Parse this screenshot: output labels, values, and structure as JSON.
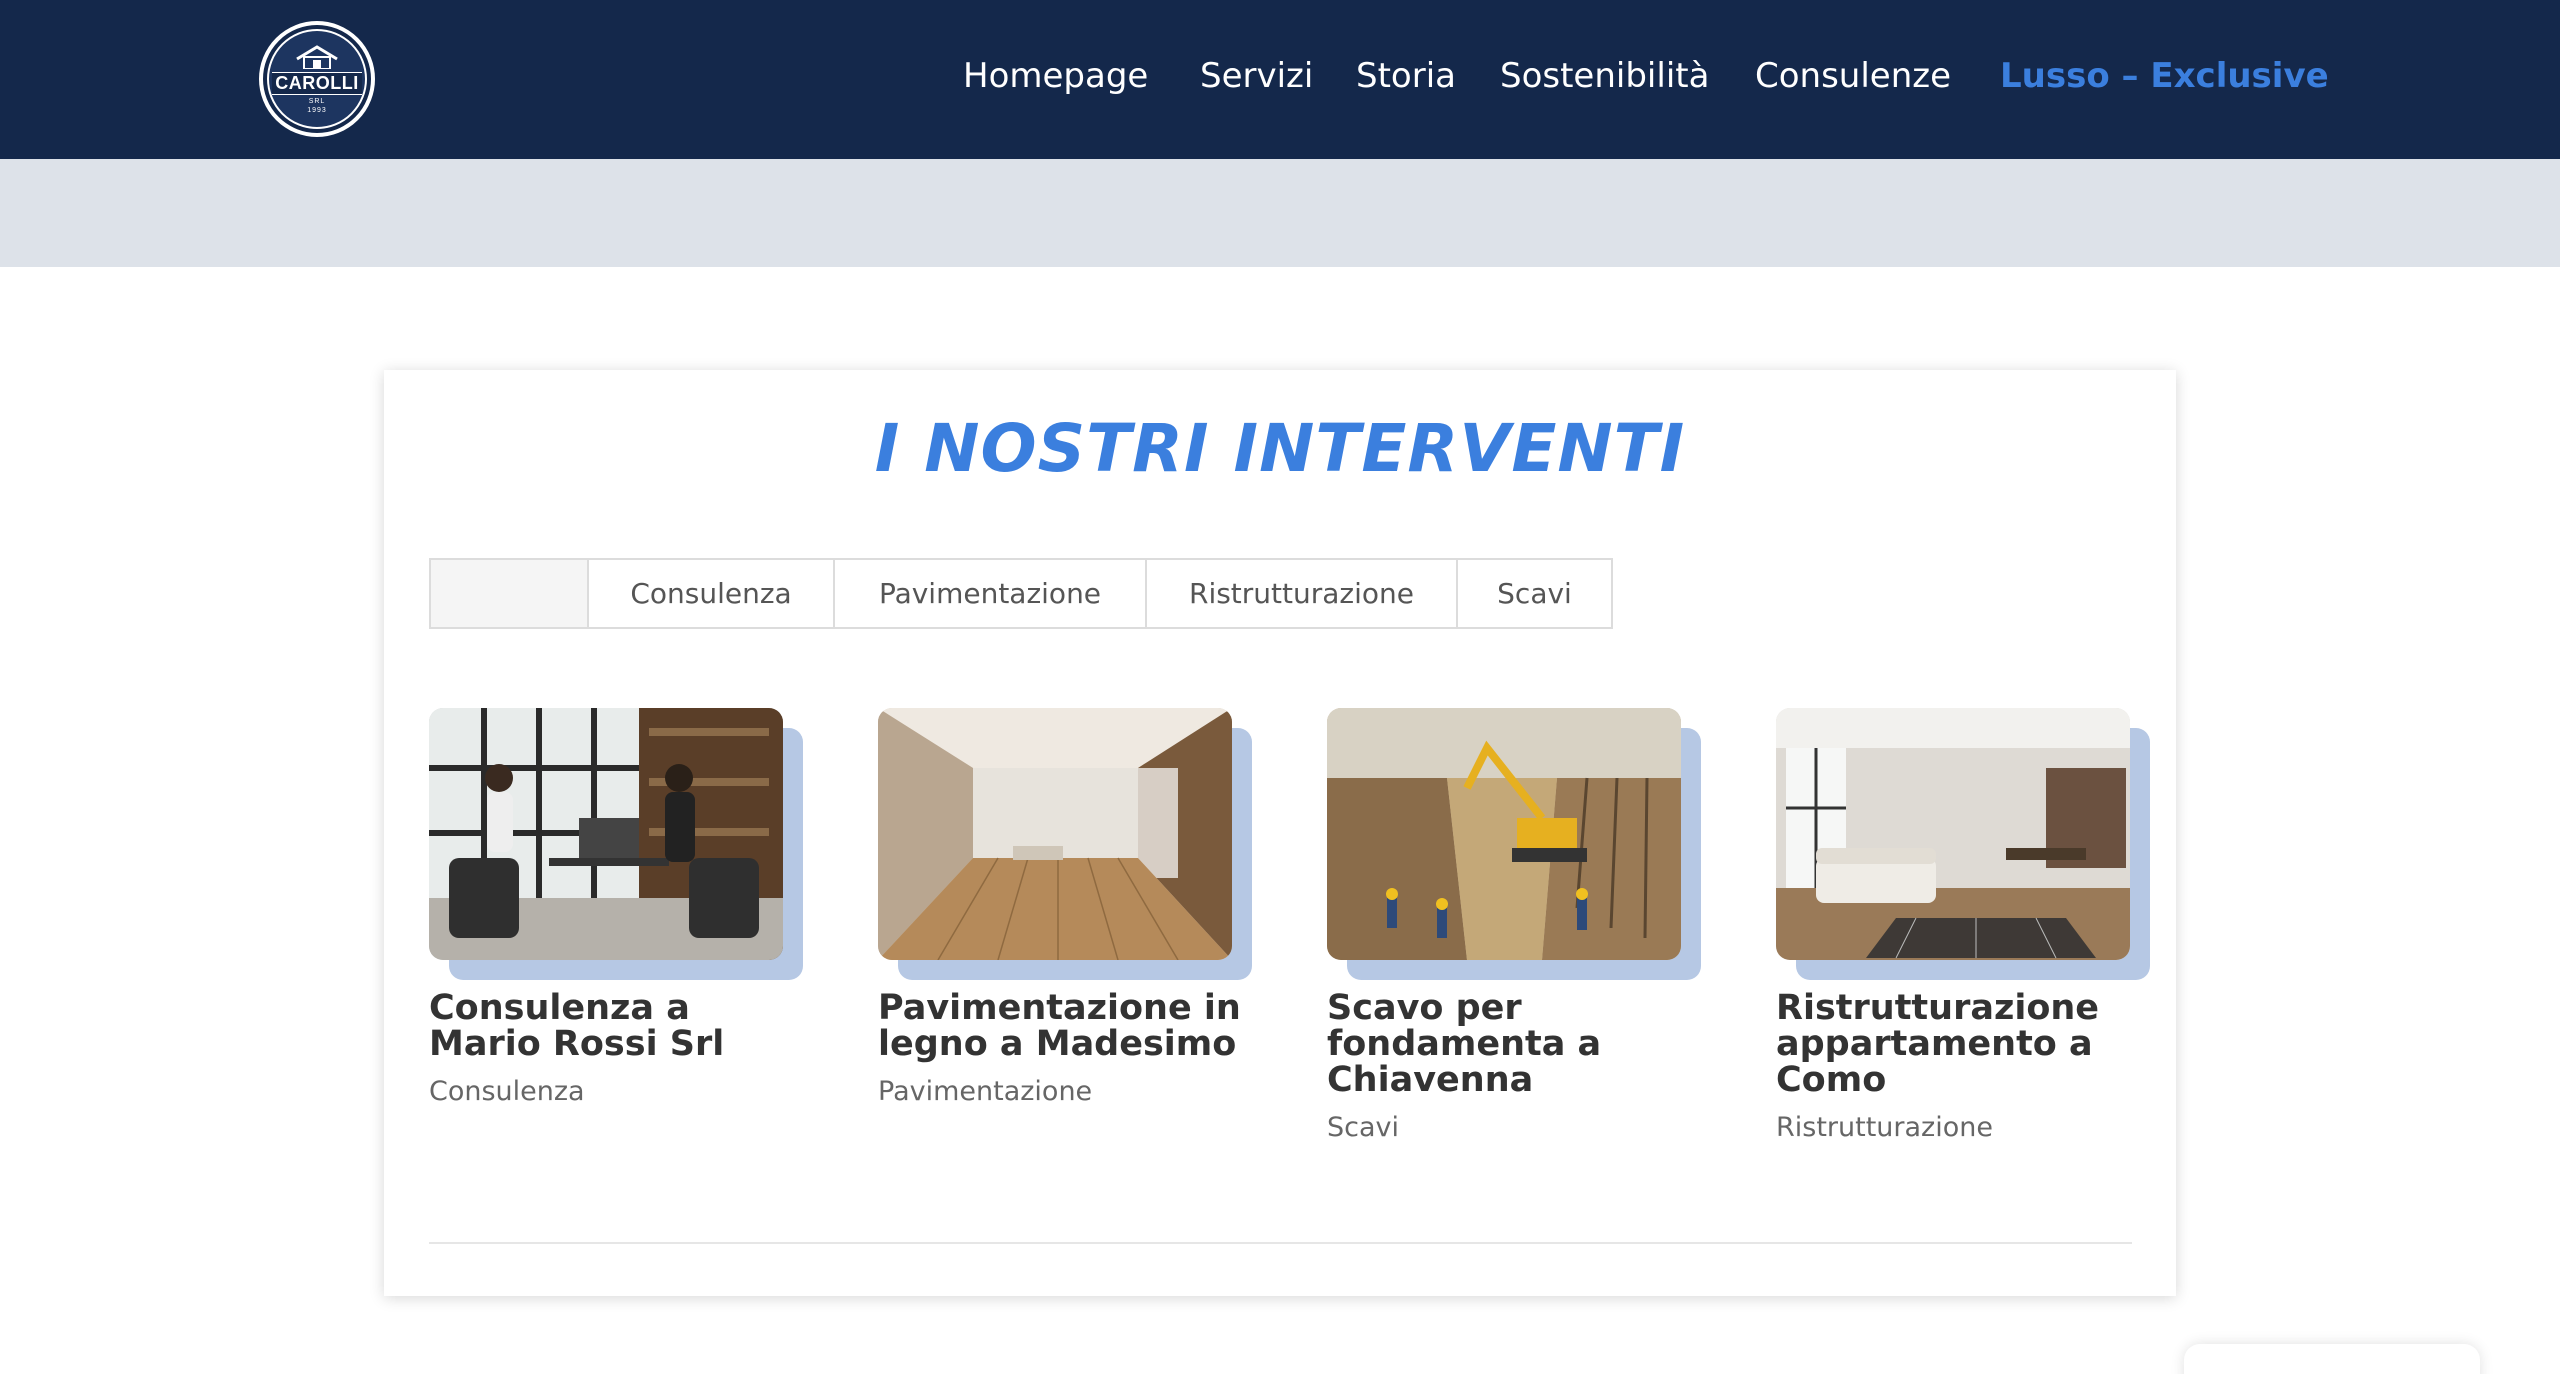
{
  "brand": {
    "logo_name": "CAROLLI",
    "logo_sub": "SRL",
    "logo_year": "1993"
  },
  "nav": {
    "items": [
      {
        "label": "Homepage"
      },
      {
        "label": "Servizi"
      },
      {
        "label": "Storia"
      },
      {
        "label": "Sostenibilità"
      },
      {
        "label": "Consulenze"
      },
      {
        "label": "Lusso – Exclusive"
      }
    ],
    "active_index": 5
  },
  "section": {
    "title": "I NOSTRI INTERVENTI"
  },
  "filters": [
    {
      "label": ""
    },
    {
      "label": "Consulenza"
    },
    {
      "label": "Pavimentazione"
    },
    {
      "label": "Ristrutturazione"
    },
    {
      "label": "Scavi"
    }
  ],
  "portfolio": [
    {
      "title": "Consulenza a Mario Rossi Srl",
      "category": "Consulenza",
      "image": "meeting-photo"
    },
    {
      "title": "Pavimentazione in legno a Madesimo",
      "category": "Pavimentazione",
      "image": "wood-floor-photo"
    },
    {
      "title": "Scavo per fondamenta a Chiavenna",
      "category": "Scavi",
      "image": "excavation-photo"
    },
    {
      "title": "Ristrutturazione appartamento a Como",
      "category": "Ristrutturazione",
      "image": "apartment-photo"
    }
  ],
  "colors": {
    "header_bg": "#14284b",
    "accent": "#3b7fde",
    "band_bg": "#dde2e9",
    "thumb_shadow": "#b6c8e4"
  }
}
